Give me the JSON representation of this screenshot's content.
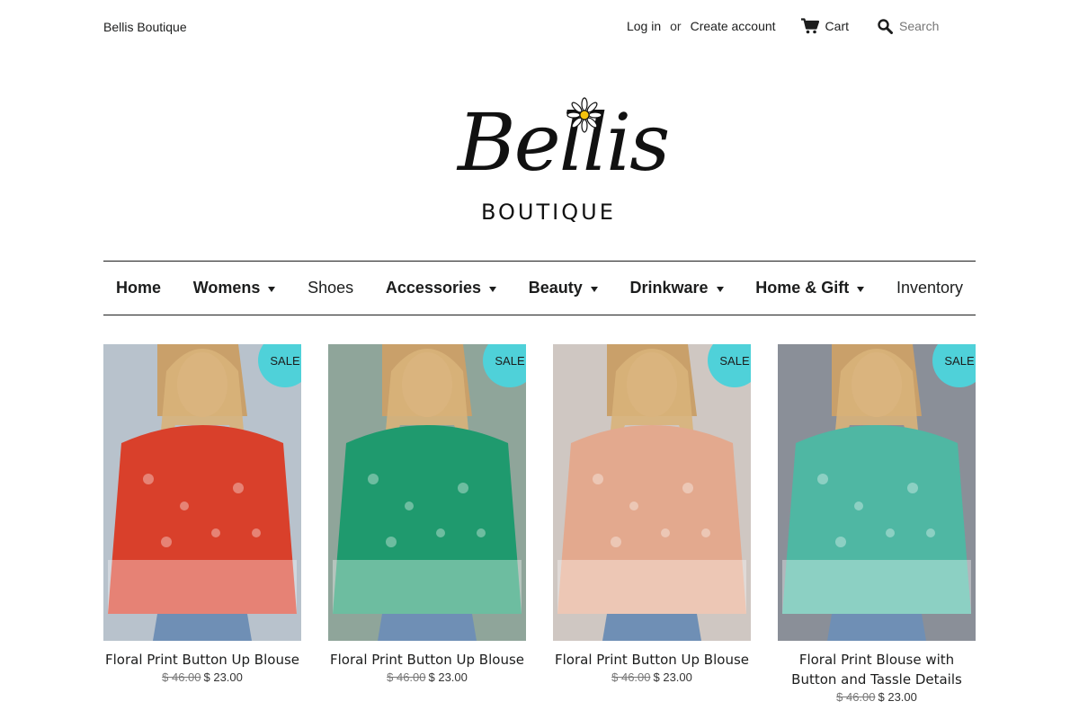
{
  "header": {
    "store_name": "Bellis Boutique",
    "login_label": "Log in",
    "or_label": "or",
    "create_account_label": "Create account",
    "cart_label": "Cart",
    "search_placeholder": "Search",
    "cart_icon": "cart-icon",
    "search_icon": "search-icon"
  },
  "logo": {
    "script_text": "Bellis",
    "sub_text": "BOUTIQUE"
  },
  "nav": {
    "items": [
      {
        "label": "Home",
        "dropdown": false
      },
      {
        "label": "Womens",
        "dropdown": true
      },
      {
        "label": "Shoes",
        "dropdown": false
      },
      {
        "label": "Accessories",
        "dropdown": true
      },
      {
        "label": "Beauty",
        "dropdown": true
      },
      {
        "label": "Drinkware",
        "dropdown": true
      },
      {
        "label": "Home & Gift",
        "dropdown": true
      },
      {
        "label": "Inventory",
        "dropdown": false
      }
    ]
  },
  "products": [
    {
      "title": "Floral Print Button Up Blouse",
      "old_price": "$ 46.00",
      "price": "$ 23.00",
      "badge": "SALE",
      "color": "#d9402b"
    },
    {
      "title": "Floral Print Button Up Blouse",
      "old_price": "$ 46.00",
      "price": "$ 23.00",
      "badge": "SALE",
      "color": "#1f9a6e"
    },
    {
      "title": "Floral Print Button Up Blouse",
      "old_price": "$ 46.00",
      "price": "$ 23.00",
      "badge": "SALE",
      "color": "#e3a98e"
    },
    {
      "title": "Floral Print Blouse with Button and Tassle Details",
      "old_price": "$ 46.00",
      "price": "$ 23.00",
      "badge": "SALE",
      "color": "#4fb7a3"
    }
  ],
  "colors": {
    "accent_badge": "#4fd1d9",
    "text": "#1c1d1d"
  }
}
